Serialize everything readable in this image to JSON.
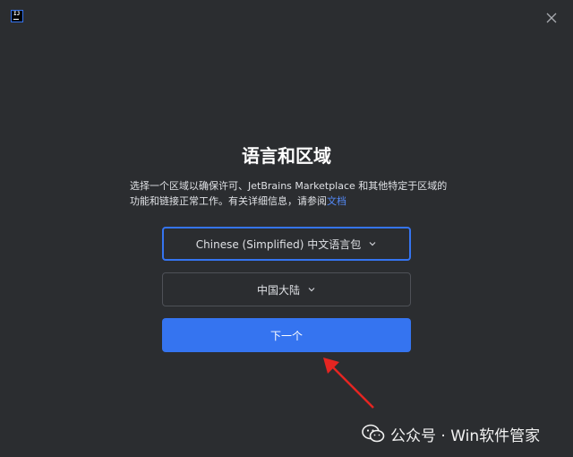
{
  "window": {
    "logo_text": "IJ",
    "close_icon": "close-icon"
  },
  "content": {
    "title": "语言和区域",
    "description": "选择一个区域以确保许可、JetBrains Marketplace 和其他特定于区域的功能和链接正常工作。有关详细信息，请参阅",
    "docs_link": "文档"
  },
  "language_select": {
    "value": "Chinese (Simplified) 中文语言包",
    "icon": "chevron-down-icon"
  },
  "region_select": {
    "value": "中国大陆",
    "icon": "chevron-down-icon"
  },
  "next_button": {
    "label": "下一个"
  },
  "watermark": {
    "text": "公众号 · Win软件管家"
  },
  "colors": {
    "background": "#2b2d30",
    "accent": "#3574f0",
    "link": "#548af7",
    "arrow": "#e52521"
  }
}
